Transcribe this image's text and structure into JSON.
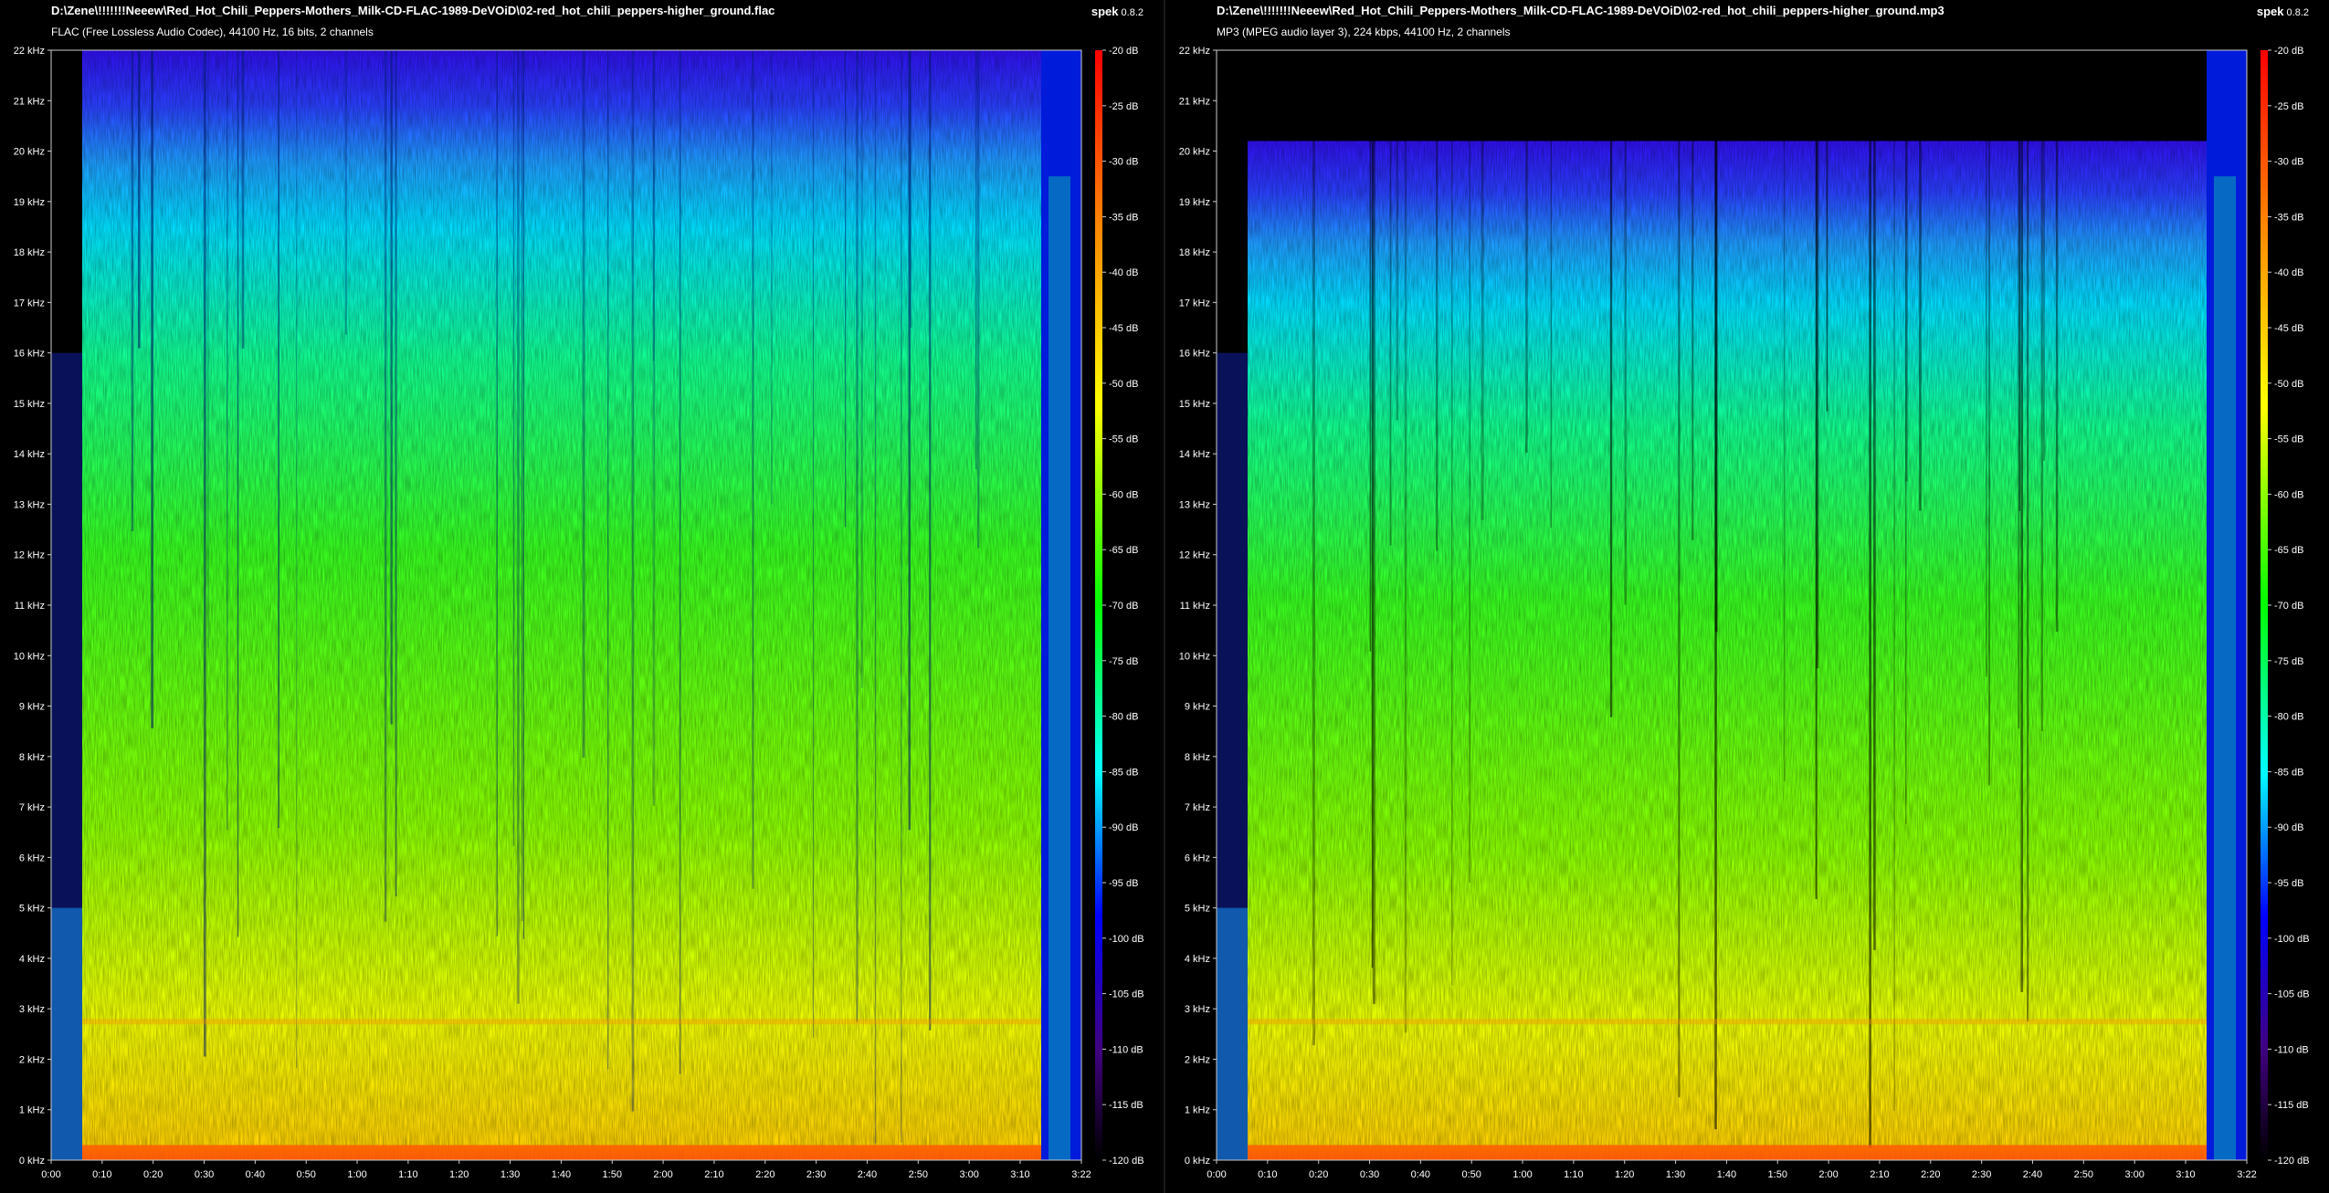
{
  "app": {
    "name": "spek",
    "version": "0.8.2"
  },
  "panes": [
    {
      "id": "flac",
      "path": "D:\\Zene\\!!!!!!!Neeew\\Red_Hot_Chili_Peppers-Mothers_Milk-CD-FLAC-1989-DeVOiD\\02-red_hot_chili_peppers-higher_ground.flac",
      "info": "FLAC (Free Lossless Audio Codec), 44100 Hz, 16 bits, 2 channels",
      "cutoff_khz": 22
    },
    {
      "id": "mp3",
      "path": "D:\\Zene\\!!!!!!!Neeew\\Red_Hot_Chili_Peppers-Mothers_Milk-CD-FLAC-1989-DeVOiD\\02-red_hot_chili_peppers-higher_ground.mp3",
      "info": "MP3 (MPEG audio layer 3), 224 kbps, 44100 Hz, 2 channels",
      "cutoff_khz": 20.2
    }
  ],
  "axes": {
    "freq_ticks": [
      "0 kHz",
      "1 kHz",
      "2 kHz",
      "3 kHz",
      "4 kHz",
      "5 kHz",
      "6 kHz",
      "7 kHz",
      "8 kHz",
      "9 kHz",
      "10 kHz",
      "11 kHz",
      "12 kHz",
      "13 kHz",
      "14 kHz",
      "15 kHz",
      "16 kHz",
      "17 kHz",
      "18 kHz",
      "19 kHz",
      "20 kHz",
      "21 kHz",
      "22 kHz"
    ],
    "freq_max_khz": 22,
    "time_ticks": [
      "0:00",
      "0:10",
      "0:20",
      "0:30",
      "0:40",
      "0:50",
      "1:00",
      "1:10",
      "1:20",
      "1:30",
      "1:40",
      "1:50",
      "2:00",
      "2:10",
      "2:20",
      "2:30",
      "2:40",
      "2:50",
      "3:00",
      "3:10",
      "3:22"
    ],
    "duration_s": 202,
    "db_ticks": [
      "-20 dB",
      "-25 dB",
      "-30 dB",
      "-35 dB",
      "-40 dB",
      "-45 dB",
      "-50 dB",
      "-55 dB",
      "-60 dB",
      "-65 dB",
      "-70 dB",
      "-75 dB",
      "-80 dB",
      "-85 dB",
      "-90 dB",
      "-95 dB",
      "-100 dB",
      "-105 dB",
      "-110 dB",
      "-115 dB",
      "-120 dB"
    ]
  },
  "colors": {
    "background": "#000000",
    "frame": "#cccccc",
    "palette": [
      "#ff0000",
      "#ff8000",
      "#ffff00",
      "#00ff00",
      "#00ffff",
      "#0000ff",
      "#400080",
      "#000000"
    ]
  }
}
